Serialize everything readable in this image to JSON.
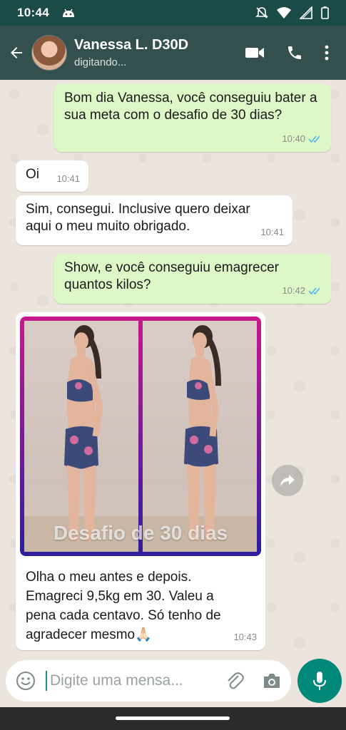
{
  "status_bar": {
    "time": "10:44"
  },
  "header": {
    "contact_name": "Vanessa L. D30D",
    "contact_status": "digitando..."
  },
  "messages": [
    {
      "direction": "outgoing",
      "text": "Bom dia Vanessa, você conseguiu bater a sua meta com o desafio de 30 dias?",
      "time": "10:40",
      "read": true
    },
    {
      "direction": "incoming",
      "text": "Oi",
      "time": "10:41"
    },
    {
      "direction": "incoming",
      "text": "Sim, consegui. Inclusive quero deixar aqui o meu muito obrigado.",
      "time": "10:41"
    },
    {
      "direction": "outgoing",
      "text": "Show, e você conseguiu emagrecer quantos kilos?",
      "time": "10:42",
      "read": true
    },
    {
      "direction": "incoming",
      "type": "image",
      "image_caption": "Desafio de 30 dias",
      "text": "Olha o meu antes e depois. Emagreci 9,5kg em 30. Valeu a pena cada centavo. Só tenho de agradecer mesmo🙏🏻",
      "time": "10:43"
    }
  ],
  "input": {
    "placeholder": "Digite uma mensa..."
  },
  "colors": {
    "header": "#34504e",
    "status_bar": "#1b4b46",
    "outgoing_bubble": "#dcf8c6",
    "incoming_bubble": "#ffffff",
    "read_tick": "#4fb6ec",
    "mic_button": "#00897b"
  },
  "icons": [
    "back-arrow-icon",
    "video-call-icon",
    "phone-icon",
    "more-vert-icon",
    "emoji-icon",
    "attach-icon",
    "camera-icon",
    "mic-icon",
    "forward-icon",
    "mute-icon",
    "wifi-icon",
    "signal-icon",
    "battery-icon",
    "android-robot-icon"
  ]
}
